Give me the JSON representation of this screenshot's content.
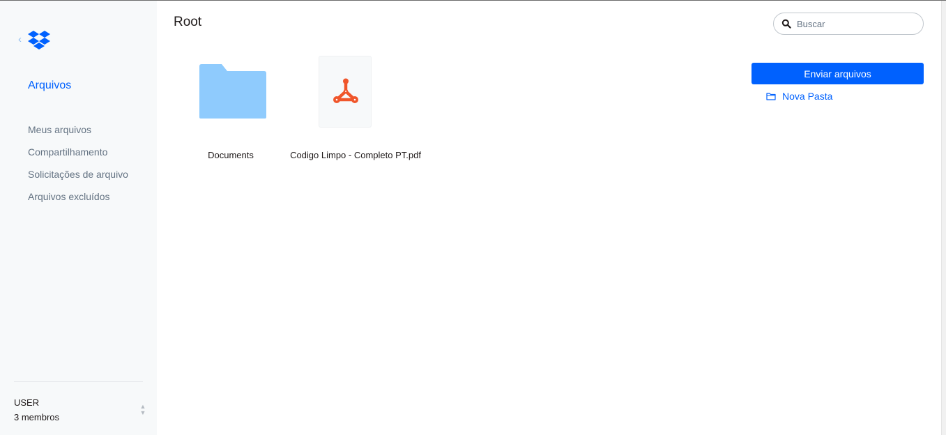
{
  "sidebar": {
    "section_title": "Arquivos",
    "items": [
      {
        "label": "Meus arquivos"
      },
      {
        "label": "Compartilhamento"
      },
      {
        "label": "Solicitações de arquivo"
      },
      {
        "label": "Arquivos excluídos"
      }
    ],
    "account": {
      "name": "USER",
      "members": "3 membros"
    }
  },
  "header": {
    "title": "Root",
    "search_placeholder": "Buscar"
  },
  "files": [
    {
      "name": "Documents",
      "kind": "folder-icon"
    },
    {
      "name": "Codigo Limpo - Completo PT.pdf",
      "kind": "pdf-icon"
    }
  ],
  "actions": {
    "upload_label": "Enviar arquivos",
    "new_folder_label": "Nova Pasta"
  },
  "colors": {
    "accent": "#0061fe",
    "folder": "#8fcbfd",
    "pdf": "#f0562b",
    "sidebar_bg": "#f7f9fa"
  }
}
